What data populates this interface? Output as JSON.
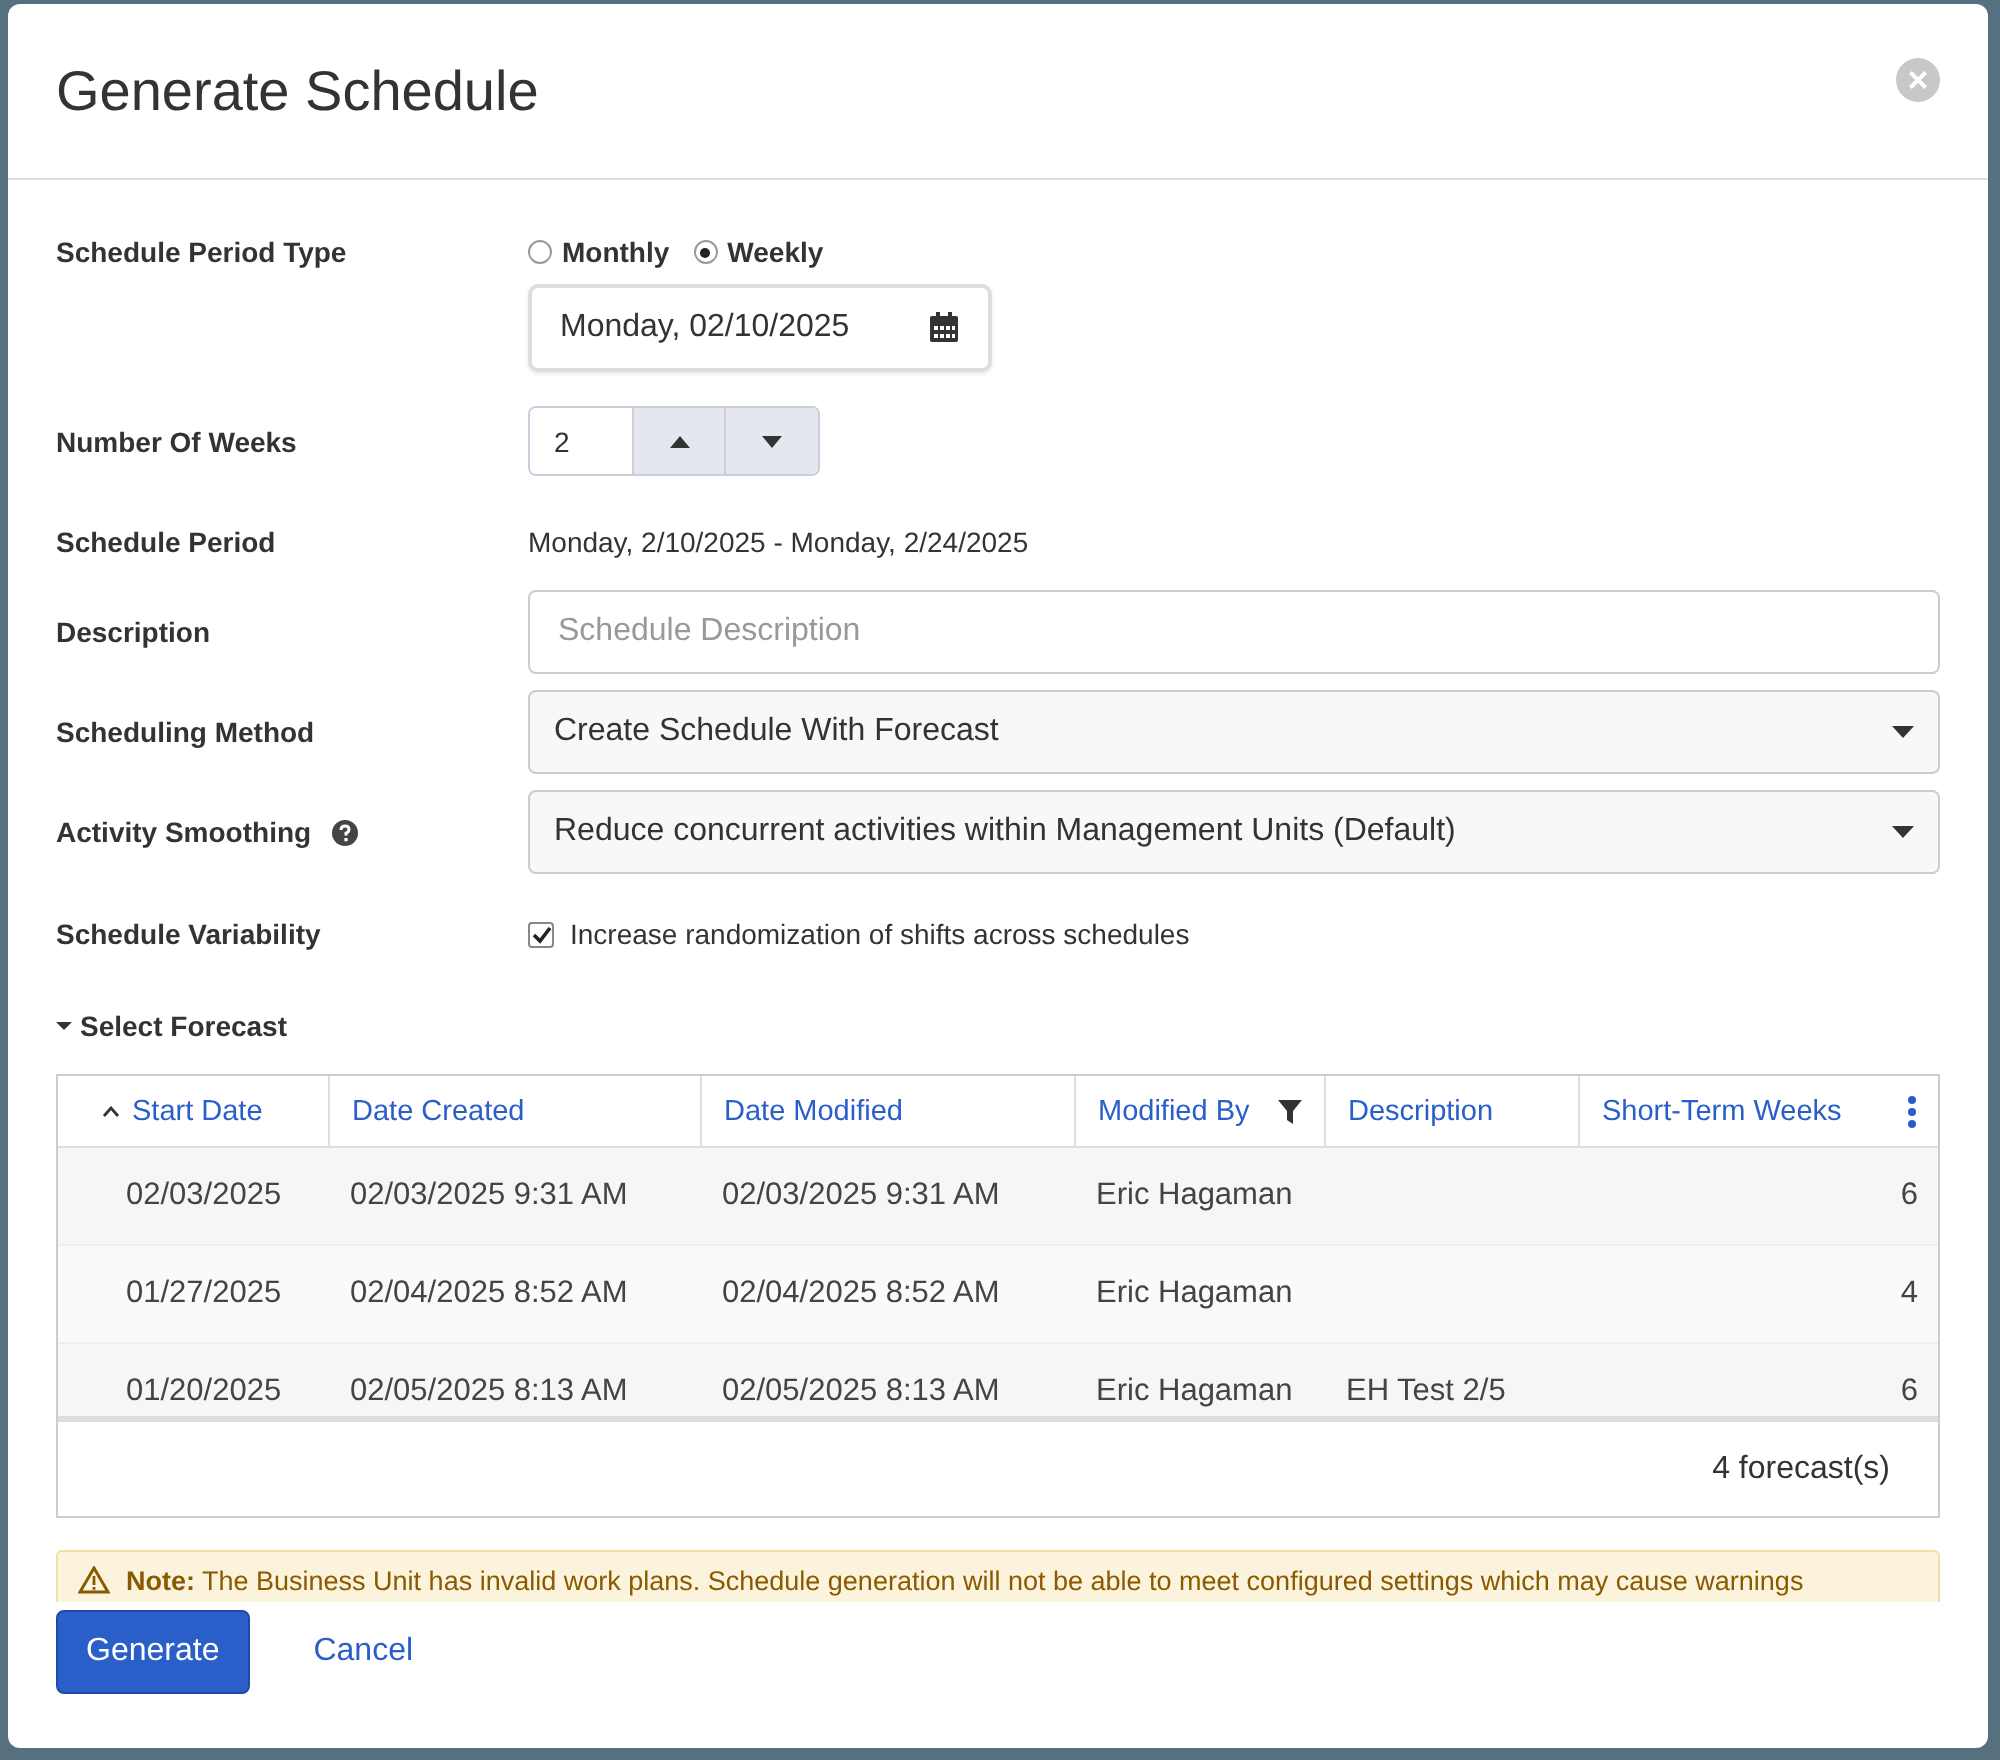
{
  "dialog": {
    "title": "Generate Schedule",
    "close": "×"
  },
  "form": {
    "period_type": {
      "label": "Schedule Period Type",
      "options": [
        {
          "label": "Monthly",
          "selected": false
        },
        {
          "label": "Weekly",
          "selected": true
        }
      ],
      "date": "Monday, 02/10/2025"
    },
    "weeks": {
      "label": "Number Of Weeks",
      "value": "2"
    },
    "period": {
      "label": "Schedule Period",
      "value": "Monday, 2/10/2025 - Monday, 2/24/2025"
    },
    "description": {
      "label": "Description",
      "placeholder": "Schedule Description"
    },
    "method": {
      "label": "Scheduling Method",
      "value": "Create Schedule With Forecast"
    },
    "smoothing": {
      "label": "Activity Smoothing",
      "value": "Reduce concurrent activities within Management Units (Default)"
    },
    "variability": {
      "label": "Schedule Variability",
      "checkbox": "Increase randomization of shifts across schedules",
      "checked": true
    }
  },
  "forecast": {
    "title": "Select Forecast",
    "expanded": true,
    "columns": [
      {
        "label": "Start Date",
        "sorted": true,
        "filter": false
      },
      {
        "label": "Date Created",
        "sorted": false,
        "filter": false
      },
      {
        "label": "Date Modified",
        "sorted": false,
        "filter": false
      },
      {
        "label": "Modified By",
        "sorted": false,
        "filter": true
      },
      {
        "label": "Description",
        "sorted": false,
        "filter": false
      },
      {
        "label": "Short-Term Weeks",
        "sorted": false,
        "filter": false
      }
    ],
    "rows": [
      [
        "02/03/2025",
        "02/03/2025 9:31 AM",
        "02/03/2025 9:31 AM",
        "Eric Hagaman",
        "",
        "6"
      ],
      [
        "01/27/2025",
        "02/04/2025 8:52 AM",
        "02/04/2025 8:52 AM",
        "Eric Hagaman",
        "",
        "4"
      ],
      [
        "01/20/2025",
        "02/05/2025 8:13 AM",
        "02/05/2025 8:13 AM",
        "Eric Hagaman",
        "EH Test 2/5",
        "6"
      ]
    ],
    "count": "4 forecast(s)"
  },
  "note": "**Note:** The Business Unit has invalid work plans. Schedule generation will not be able to meet configured settings which may cause warnings",
  "buttons": [
    {
      "label": "Generate",
      "kind": "primary"
    },
    {
      "label": "Cancel",
      "kind": "link"
    }
  ]
}
